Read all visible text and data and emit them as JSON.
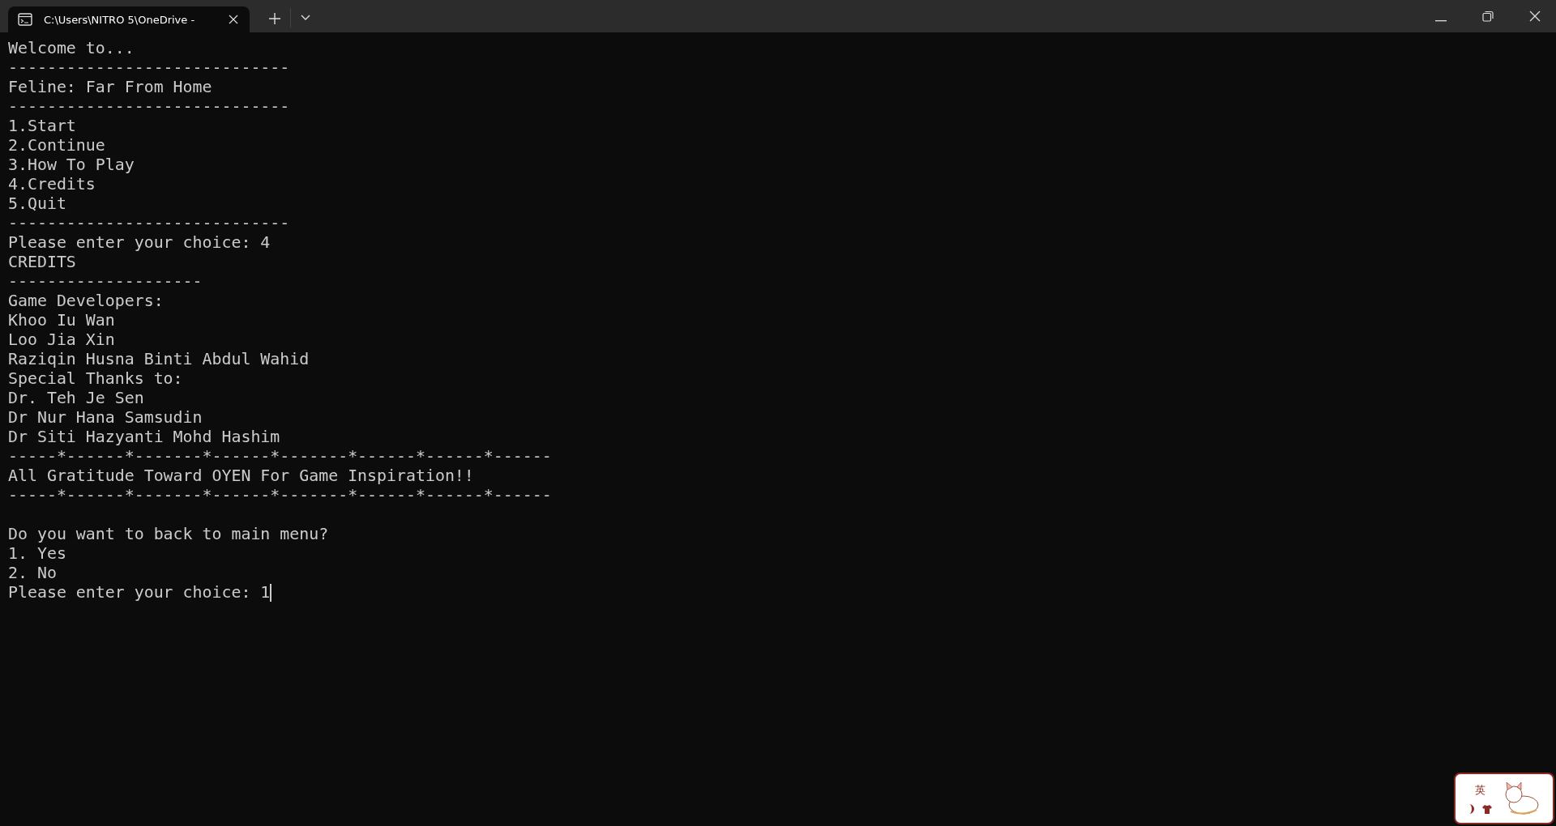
{
  "tabs": [
    {
      "title": "C:\\Users\\NITRO 5\\OneDrive -",
      "selected": true
    }
  ],
  "terminal": {
    "lines": [
      {
        "kind": "text",
        "text": "Welcome to..."
      },
      {
        "kind": "text",
        "text": "-----------------------------"
      },
      {
        "kind": "text",
        "text": "Feline: Far From Home"
      },
      {
        "kind": "text",
        "text": "-----------------------------"
      },
      {
        "kind": "text",
        "text": "1.Start"
      },
      {
        "kind": "text",
        "text": "2.Continue"
      },
      {
        "kind": "text",
        "text": "3.How To Play"
      },
      {
        "kind": "text",
        "text": "4.Credits"
      },
      {
        "kind": "text",
        "text": "5.Quit"
      },
      {
        "kind": "text",
        "text": "-----------------------------"
      },
      {
        "kind": "text",
        "text": "Please enter your choice: 4"
      },
      {
        "kind": "text",
        "text": "CREDITS"
      },
      {
        "kind": "text",
        "text": "--------------------"
      },
      {
        "kind": "text",
        "text": "Game Developers:"
      },
      {
        "kind": "text",
        "text": "Khoo Iu Wan"
      },
      {
        "kind": "text",
        "text": "Loo Jia Xin"
      },
      {
        "kind": "text",
        "text": "Raziqin Husna Binti Abdul Wahid"
      },
      {
        "kind": "text",
        "text": "Special Thanks to:"
      },
      {
        "kind": "text",
        "text": "Dr. Teh Je Sen"
      },
      {
        "kind": "text",
        "text": "Dr Nur Hana Samsudin"
      },
      {
        "kind": "text",
        "text": "Dr Siti Hazyanti Mohd Hashim"
      },
      {
        "kind": "text",
        "text": "-----*------*-------*------*-------*------*------*------"
      },
      {
        "kind": "text",
        "text": "All Gratitude Toward OYEN For Game Inspiration!!"
      },
      {
        "kind": "text",
        "text": "-----*------*-------*------*-------*------*------*------"
      },
      {
        "kind": "blank"
      },
      {
        "kind": "text",
        "text": "Do you want to back to main menu?"
      },
      {
        "kind": "text",
        "text": "1. Yes"
      },
      {
        "kind": "text",
        "text": "2. No"
      },
      {
        "kind": "text",
        "text": "Please enter your choice: 1"
      }
    ],
    "cursor_visible": true
  },
  "ime_indicator": {
    "mode": "英"
  }
}
